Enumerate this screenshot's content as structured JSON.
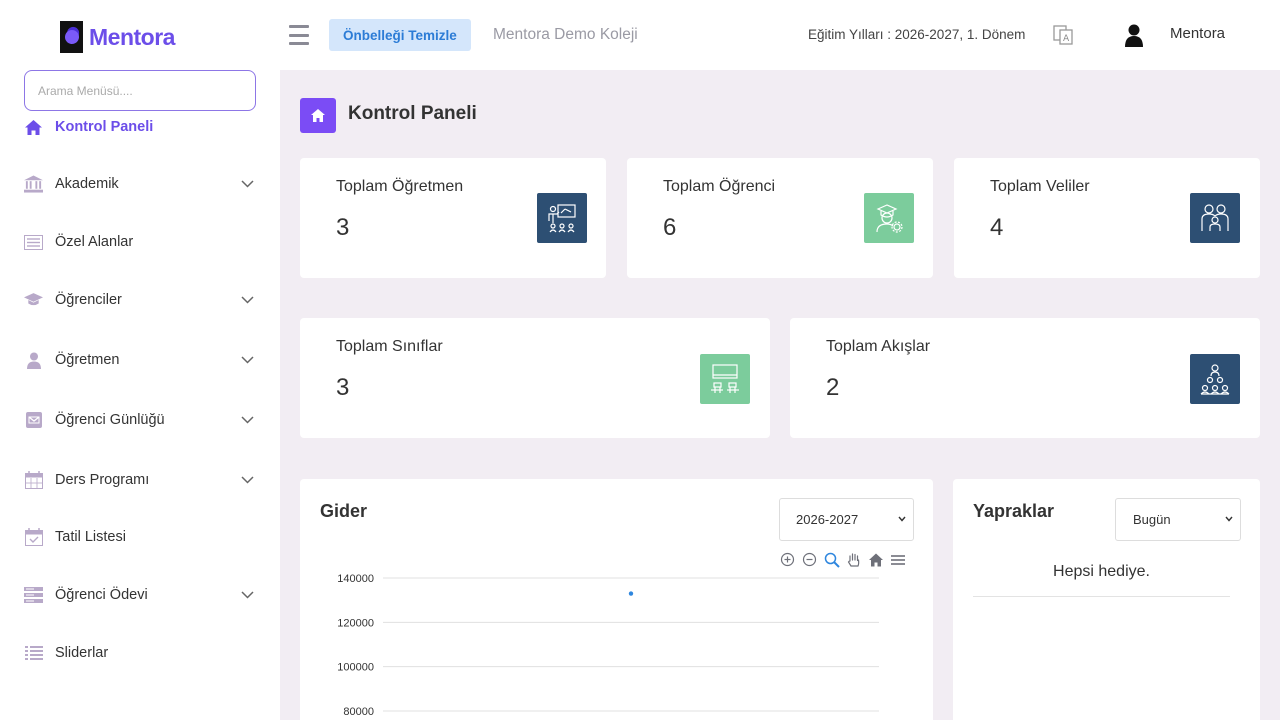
{
  "app": {
    "logo_text": "Mentora",
    "search_placeholder": "Arama Menüsü....",
    "accent_color": "#6c4ee9"
  },
  "sidebar": {
    "items": [
      {
        "label": "Kontrol Paneli",
        "icon": "home-icon",
        "active": true,
        "has_submenu": false
      },
      {
        "label": "Akademik",
        "icon": "bank-icon",
        "active": false,
        "has_submenu": true
      },
      {
        "label": "Özel Alanlar",
        "icon": "list-box-icon",
        "active": false,
        "has_submenu": false
      },
      {
        "label": "Öğrenciler",
        "icon": "graduation-cap-icon",
        "active": false,
        "has_submenu": true
      },
      {
        "label": "Öğretmen",
        "icon": "user-icon",
        "active": false,
        "has_submenu": true
      },
      {
        "label": "Öğrenci Günlüğü",
        "icon": "envelope-icon",
        "active": false,
        "has_submenu": true
      },
      {
        "label": "Ders Programı",
        "icon": "calendar-icon",
        "active": false,
        "has_submenu": true
      },
      {
        "label": "Tatil Listesi",
        "icon": "calendar-check-icon",
        "active": false,
        "has_submenu": false
      },
      {
        "label": "Öğrenci Ödevi",
        "icon": "server-icon",
        "active": false,
        "has_submenu": true
      },
      {
        "label": "Sliderlar",
        "icon": "list-icon",
        "active": false,
        "has_submenu": false
      }
    ]
  },
  "header": {
    "clear_cache_label": "Önbelleği Temizle",
    "school_name": "Mentora Demo Koleji",
    "education_year": "Eğitim Yılları : 2026-2027, 1. Dönem",
    "user_name": "Mentora"
  },
  "page": {
    "title": "Kontrol Paneli"
  },
  "stats": [
    {
      "label": "Toplam Öğretmen",
      "value": "3",
      "icon": "teacher-board-icon",
      "color": "#2d4f73"
    },
    {
      "label": "Toplam Öğrenci",
      "value": "6",
      "icon": "student-gear-icon",
      "color": "#7ccc9c"
    },
    {
      "label": "Toplam Veliler",
      "value": "4",
      "icon": "family-icon",
      "color": "#2d4f73"
    },
    {
      "label": "Toplam Sınıflar",
      "value": "3",
      "icon": "classroom-icon",
      "color": "#7ccc9c"
    },
    {
      "label": "Toplam Akışlar",
      "value": "2",
      "icon": "hierarchy-icon",
      "color": "#2d4f73"
    }
  ],
  "expense": {
    "title": "Gider",
    "selected_year": "2026-2027",
    "chart_data": {
      "type": "scatter",
      "title": "Gider",
      "xlabel": "",
      "ylabel": "",
      "y_ticks": [
        140000,
        120000,
        100000,
        80000
      ],
      "ylim": [
        80000,
        140000
      ],
      "series": [
        {
          "values": [
            {
              "x": 0,
              "y": 133000
            }
          ]
        }
      ],
      "grid": true,
      "point_color": "#2e86de"
    }
  },
  "leaves": {
    "title": "Yapraklar",
    "selected_period": "Bugün",
    "empty_message": "Hepsi hediye."
  }
}
